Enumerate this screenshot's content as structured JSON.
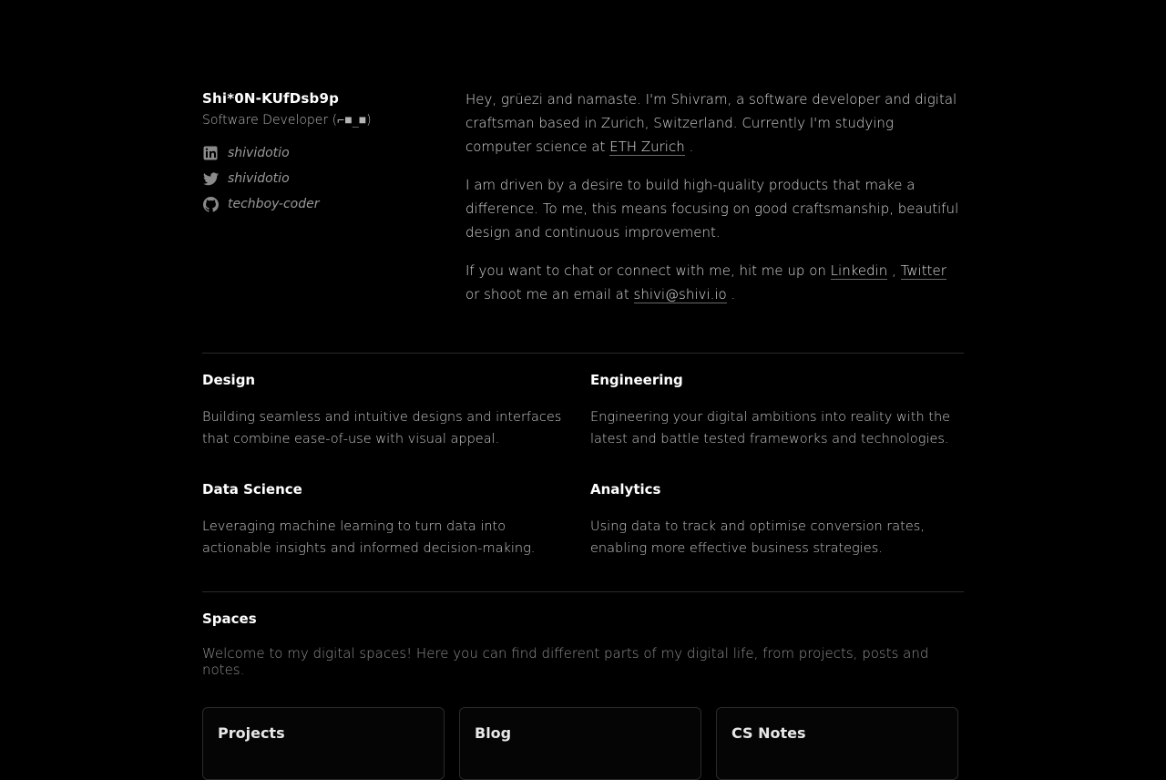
{
  "profile": {
    "name": "Shi*0N-KUfDsb9p",
    "role": "Software Developer (⌐■_■)",
    "socials": [
      {
        "icon": "linkedin-icon",
        "handle": "shividotio"
      },
      {
        "icon": "twitter-icon",
        "handle": "shividotio"
      },
      {
        "icon": "github-icon",
        "handle": "techboy-coder"
      }
    ]
  },
  "about": {
    "p1_text": "Hey, grüezi and namaste. I'm Shivram, a software developer and digital craftsman based in Zurich, Switzerland. Currently I'm studying computer science at ",
    "p1_link": "ETH Zurich",
    "p1_end": " .",
    "p2": "I am driven by a desire to build high-quality products that make a difference. To me, this means focusing on good craftsmanship, beautiful design and continuous improvement.",
    "p3_text": "If you want to chat or connect with me, hit me up on ",
    "p3_link1": "Linkedin",
    "p3_sep": " , ",
    "p3_link2": "Twitter",
    "p3_mid": " or shoot me an email at ",
    "p3_link3": "shivi@shivi.io",
    "p3_end": " ."
  },
  "skills": [
    {
      "title": "Design",
      "desc": "Building seamless and intuitive designs and interfaces that combine ease-of-use with visual appeal."
    },
    {
      "title": "Engineering",
      "desc": "Engineering your digital ambitions into reality with the latest and battle tested frameworks and technologies."
    },
    {
      "title": "Data Science",
      "desc": "Leveraging machine learning to turn data into actionable insights and informed decision-making."
    },
    {
      "title": "Analytics",
      "desc": "Using data to track and optimise conversion rates, enabling more effective business strategies."
    }
  ],
  "spaces": {
    "title": "Spaces",
    "desc": "Welcome to my digital spaces! Here you can find different parts of my digital life, from projects, posts and notes.",
    "cards": [
      {
        "title": "Projects"
      },
      {
        "title": "Blog"
      },
      {
        "title": "CS Notes"
      }
    ]
  },
  "colors": {
    "background": "#000000",
    "text": "#d4d4d4",
    "heading": "#ffffff",
    "divider": "#2a2a2a"
  }
}
